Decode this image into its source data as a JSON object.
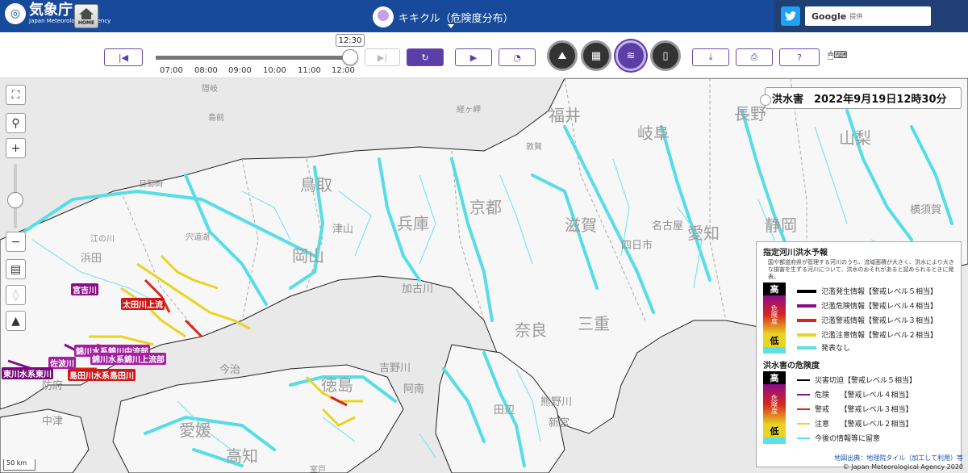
{
  "header": {
    "logo_jp": "気象庁",
    "logo_en": "Japan Meteorological Agency",
    "home_label": "HOME",
    "title": "キキクル（危険度分布）",
    "google_label": "Google",
    "google_sub": "提供"
  },
  "controls": {
    "current_time": "12:30",
    "time_ticks": [
      "07:00",
      "08:00",
      "09:00",
      "10:00",
      "11:00",
      "12:00"
    ],
    "current_time_fraction": 0.98,
    "layers": [
      {
        "name": "land-slide",
        "selected": false
      },
      {
        "name": "inundation",
        "selected": false
      },
      {
        "name": "flood",
        "selected": true
      },
      {
        "name": "map",
        "selected": false
      }
    ]
  },
  "map": {
    "info_title": "洪水害　2022年9月19日12時30分",
    "places": [
      {
        "text": "福井",
        "cls": "big"
      },
      {
        "text": "長野",
        "cls": "big"
      },
      {
        "text": "岐阜",
        "cls": "big"
      },
      {
        "text": "山梨",
        "cls": "big"
      },
      {
        "text": "鳥取",
        "cls": "big"
      },
      {
        "text": "兵庫",
        "cls": "big"
      },
      {
        "text": "京都",
        "cls": "big"
      },
      {
        "text": "滋賀",
        "cls": "big"
      },
      {
        "text": "愛知",
        "cls": "big"
      },
      {
        "text": "静岡",
        "cls": "big"
      },
      {
        "text": "岡山",
        "cls": "big"
      },
      {
        "text": "奈良",
        "cls": "big"
      },
      {
        "text": "三重",
        "cls": "big"
      },
      {
        "text": "徳島",
        "cls": "big"
      },
      {
        "text": "愛媛",
        "cls": "big"
      },
      {
        "text": "高知",
        "cls": "big"
      },
      {
        "text": "名古屋",
        "cls": "mid"
      },
      {
        "text": "横須賀",
        "cls": "mid"
      },
      {
        "text": "浜田",
        "cls": "mid"
      },
      {
        "text": "津山",
        "cls": "mid"
      },
      {
        "text": "加古川",
        "cls": "mid"
      },
      {
        "text": "田辺",
        "cls": "mid"
      },
      {
        "text": "新宮",
        "cls": "mid"
      },
      {
        "text": "阿南",
        "cls": "mid"
      },
      {
        "text": "吉野川",
        "cls": "mid"
      },
      {
        "text": "熊野川",
        "cls": "mid"
      },
      {
        "text": "四日市",
        "cls": "mid"
      },
      {
        "text": "中津",
        "cls": "mid"
      },
      {
        "text": "防府",
        "cls": "mid"
      },
      {
        "text": "今治",
        "cls": "mid"
      },
      {
        "text": "宍道湖",
        "cls": "small"
      },
      {
        "text": "隠岐",
        "cls": "small"
      },
      {
        "text": "島前",
        "cls": "small"
      },
      {
        "text": "日御碕",
        "cls": "small"
      },
      {
        "text": "江の川",
        "cls": "small"
      },
      {
        "text": "経ヶ岬",
        "cls": "small"
      },
      {
        "text": "敦賀",
        "cls": "small"
      },
      {
        "text": "室戸",
        "cls": "small"
      }
    ],
    "river_labels": [
      {
        "text": "宮吉川",
        "color": "#8a0c8a"
      },
      {
        "text": "太田川上流",
        "color": "#cc1a1a"
      },
      {
        "text": "錦川水系錦川中流部",
        "color": "#a41fa0"
      },
      {
        "text": "錦川水系錦川上流部",
        "color": "#a41fa0"
      },
      {
        "text": "佐波川",
        "color": "#a41fa0"
      },
      {
        "text": "東川水系東川",
        "color": "#7a0a7a"
      },
      {
        "text": "島田川水系島田川",
        "color": "#cc1a1a"
      }
    ],
    "scale_label": "50 km",
    "credit_link": "地図出典：地理院タイル（加工して利用）等",
    "copyright": "© Japan Meteorological Agency 2020"
  },
  "legend": {
    "section1_title": "指定河川洪水予報",
    "section1_desc": "国や都道府県が管理する河川のうち、流域面積が大きく、洪水により大きな損害を生ずる河川について、洪水のおそれがあると認められるときに発表。",
    "scale_high": "高",
    "scale_low": "低",
    "scale_mid": "危険度",
    "section1_items": [
      {
        "label": "氾濫発生情報【警戒レベル５相当】",
        "color": "#000000"
      },
      {
        "label": "氾濫危険情報【警戒レベル４相当】",
        "color": "#8a0c8a"
      },
      {
        "label": "氾濫警戒情報【警戒レベル３相当】",
        "color": "#d8261c"
      },
      {
        "label": "氾濫注意情報【警戒レベル２相当】",
        "color": "#e8d422"
      },
      {
        "label": "発表なし",
        "color": "#5ee0e8"
      }
    ],
    "section2_title": "洪水害の危険度",
    "section2_items": [
      {
        "label": "災害切迫【警戒レベル５相当】",
        "color": "#000000"
      },
      {
        "label": "危険　　【警戒レベル４相当】",
        "color": "#8a0c8a"
      },
      {
        "label": "警戒　　【警戒レベル３相当】",
        "color": "#d8261c"
      },
      {
        "label": "注意　　【警戒レベル２相当】",
        "color": "#e8d422"
      },
      {
        "label": "今後の情報等に留意",
        "color": "#5ee0e8"
      }
    ]
  }
}
